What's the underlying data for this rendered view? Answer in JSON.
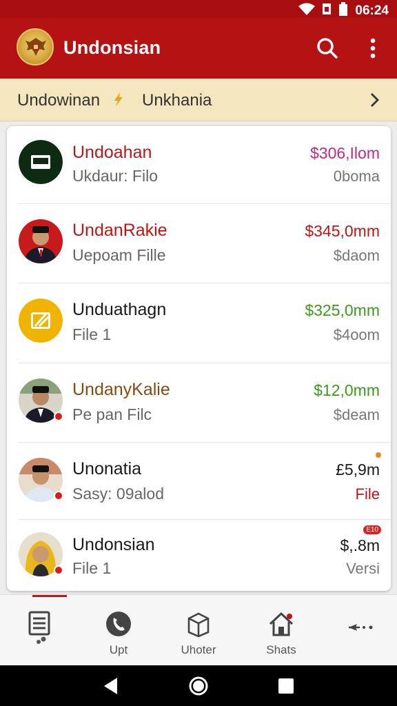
{
  "status_bar": {
    "time": "06:24"
  },
  "app_bar": {
    "title": "Undonsian",
    "logo_icon": "national-emblem-logo",
    "search_icon": "search-icon",
    "more_icon": "more-vert-icon"
  },
  "subbar": {
    "crumb1": "Undowinan",
    "crumb2": "Unkhania",
    "separator_icon": "bolt-icon",
    "chevron_icon": "chevron-right-icon"
  },
  "list": [
    {
      "title": "Undoahan",
      "subtitle": "Ukdaur: Filo",
      "amount": "$306,Ilom",
      "meta": "0boma",
      "title_color": "#b51a1a",
      "amount_color": "#c0288a",
      "meta_color": "#777777",
      "avatar": "tablet-icon"
    },
    {
      "title": "UndanRakie",
      "subtitle": "Uepoam Fille",
      "amount": "$345,0mm",
      "meta": "$daom",
      "title_color": "#c01515",
      "amount_color": "#c01515",
      "meta_color": "#777777",
      "avatar": "person-photo"
    },
    {
      "title": "Unduathagn",
      "subtitle": "File 1",
      "amount": "$325,0mm",
      "meta": "$4oom",
      "title_color": "#1a1a1a",
      "amount_color": "#3c9a1a",
      "meta_color": "#777777",
      "avatar": "edit-document-icon"
    },
    {
      "title": "UndanyKalie",
      "subtitle": "Pe pan Filc",
      "amount": "$12,0mm",
      "meta": "$deam",
      "title_color": "#8a4a0a",
      "amount_color": "#3c9a1a",
      "meta_color": "#777777",
      "avatar": "person-photo"
    },
    {
      "title": "Unonatia",
      "subtitle": "Sasy: 09alod",
      "amount": "£5,9m",
      "meta": "File",
      "title_color": "#1a1a1a",
      "amount_color": "#1a1a1a",
      "meta_color": "#c01515",
      "avatar": "person-photo"
    },
    {
      "title": "Undonsian",
      "subtitle": "File 1",
      "amount": "$,.8m",
      "meta": "Versi",
      "title_color": "#1a1a1a",
      "amount_color": "#1a1a1a",
      "meta_color": "#777777",
      "avatar": "person-photo",
      "tag": "E10"
    }
  ],
  "bottom_nav": [
    {
      "label": "",
      "icon": "document-list-icon"
    },
    {
      "label": "Upt",
      "icon": "phone-icon"
    },
    {
      "label": "Uhoter",
      "icon": "box-icon"
    },
    {
      "label": "Shats",
      "icon": "home-icon"
    },
    {
      "label": "",
      "icon": "share-dots-icon"
    }
  ],
  "colors": {
    "primary": "#b51214",
    "status_bar": "#a80d10",
    "subbar_bg": "#f4e6be"
  }
}
